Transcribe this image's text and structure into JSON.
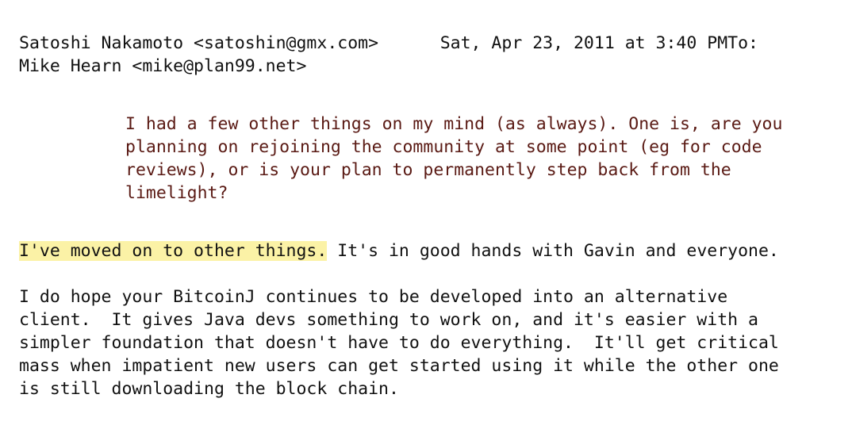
{
  "header": {
    "line1": "Satoshi Nakamoto <satoshin@gmx.com>      Sat, Apr 23, 2011 at 3:40 PMTo:",
    "line2": "Mike Hearn <mike@plan99.net>"
  },
  "quote": {
    "lines": [
      "I had a few other things on my mind (as always). One is, are you",
      "planning on rejoining the community at some point (eg for code",
      "reviews), or is your plan to permanently step back from the",
      "limelight?"
    ],
    "color": "#5a1a14"
  },
  "reply": {
    "highlighted": "I've moved on to other things.",
    "rest": " It's in good hands with Gavin and everyone.",
    "highlight_color": "#fbf2a6"
  },
  "paragraph": {
    "lines": [
      "I do hope your BitcoinJ continues to be developed into an alternative",
      "client.  It gives Java devs something to work on, and it's easier with a",
      "simpler foundation that doesn't have to do everything.  It'll get critical",
      "mass when impatient new users can get started using it while the other one",
      "is still downloading the block chain."
    ]
  }
}
